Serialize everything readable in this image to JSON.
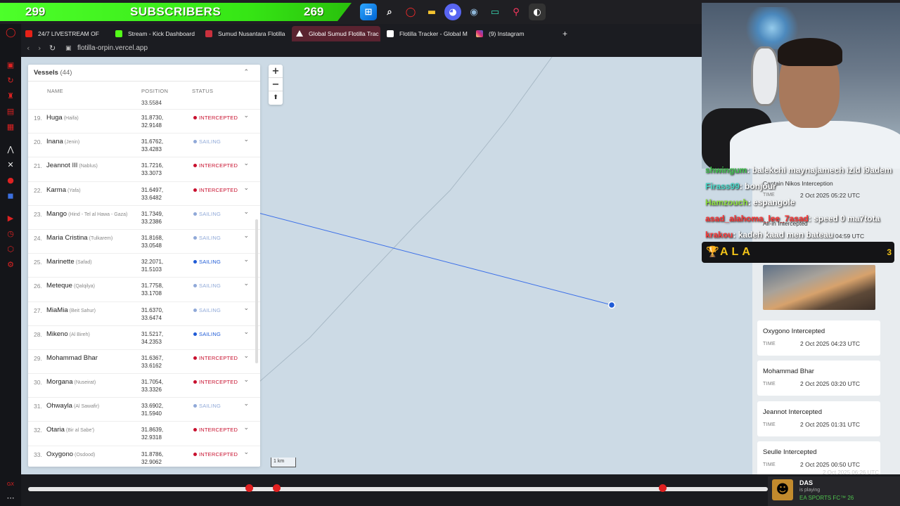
{
  "taskbar": {
    "subs_left": "299",
    "subs_label": "SUBSCRIBERS",
    "subs_right": "269",
    "icons": [
      "windows-icon",
      "search-icon",
      "opera-icon",
      "folder-icon",
      "discord-icon",
      "steam-icon",
      "app-icon",
      "location-icon",
      "game-icon"
    ]
  },
  "browser": {
    "tabs": [
      {
        "label": "24/7 LIVESTREAM OF",
        "icon_color": "#e62117"
      },
      {
        "label": "Stream - Kick Dashboard",
        "icon_color": "#53fc18"
      },
      {
        "label": "Sumud Nusantara Flotilla",
        "icon_color": "#c9303d"
      },
      {
        "label": "Global Sumud Flotilla Trac",
        "icon_color": "#ffffff"
      },
      {
        "label": "Flotilla Tracker - Global M",
        "icon_color": "#ffffff"
      },
      {
        "label": "(9) Instagram",
        "icon_color": "#d62976"
      }
    ],
    "new_tab": "+",
    "url": "flotilla-orpin.vercel.app"
  },
  "vessels": {
    "title": "Vessels",
    "count": "(44)",
    "col_name": "NAME",
    "col_position": "POSITION",
    "col_status": "STATUS",
    "partial_coord": "33.5584",
    "rows": [
      {
        "num": "19.",
        "name": "Huga",
        "city": "(Haifa)",
        "lat": "31.8730,",
        "lon": "32.9148",
        "status": "INTERCEPTED"
      },
      {
        "num": "20.",
        "name": "Inana",
        "city": "(Jenin)",
        "lat": "31.6762,",
        "lon": "33.4283",
        "status": "SAILING"
      },
      {
        "num": "21.",
        "name": "Jeannot III",
        "city": "(Nablus)",
        "lat": "31.7216,",
        "lon": "33.3073",
        "status": "INTERCEPTED"
      },
      {
        "num": "22.",
        "name": "Karma",
        "city": "(Yafa)",
        "lat": "31.6497,",
        "lon": "33.6482",
        "status": "INTERCEPTED"
      },
      {
        "num": "23.",
        "name": "Mango",
        "city": "(Hind - Tel al Hawa - Gaza)",
        "lat": "31.7349,",
        "lon": "33.2386",
        "status": "SAILING"
      },
      {
        "num": "24.",
        "name": "Maria Cristina",
        "city": "(Tulkarem)",
        "lat": "31.8168,",
        "lon": "33.0548",
        "status": "SAILING"
      },
      {
        "num": "25.",
        "name": "Marinette",
        "city": "(Safad)",
        "lat": "32.2071,",
        "lon": "31.5103",
        "status": "SAILING",
        "active": true
      },
      {
        "num": "26.",
        "name": "Meteque",
        "city": "(Qalqilya)",
        "lat": "31.7758,",
        "lon": "33.1708",
        "status": "SAILING"
      },
      {
        "num": "27.",
        "name": "MiaMia",
        "city": "(Beit Sahur)",
        "lat": "31.6370,",
        "lon": "33.6474",
        "status": "SAILING"
      },
      {
        "num": "28.",
        "name": "Mikeno",
        "city": "(Al Bireh)",
        "lat": "31.5217,",
        "lon": "34.2353",
        "status": "SAILING",
        "active": true
      },
      {
        "num": "29.",
        "name": "Mohammad Bhar",
        "city": "",
        "lat": "31.6367,",
        "lon": "33.6162",
        "status": "INTERCEPTED"
      },
      {
        "num": "30.",
        "name": "Morgana",
        "city": "(Nuseirat)",
        "lat": "31.7054,",
        "lon": "33.3326",
        "status": "INTERCEPTED"
      },
      {
        "num": "31.",
        "name": "Ohwayla",
        "city": "(Al Sawafir)",
        "lat": "33.6902,",
        "lon": "31.5940",
        "status": "SAILING"
      },
      {
        "num": "32.",
        "name": "Otaria",
        "city": "(Bir al Sabe')",
        "lat": "31.8639,",
        "lon": "32.9318",
        "status": "INTERCEPTED"
      },
      {
        "num": "33.",
        "name": "Oxygono",
        "city": "(Osdood)",
        "lat": "31.8786,",
        "lon": "32.9062",
        "status": "INTERCEPTED"
      }
    ],
    "colors": {
      "intercepted": "#c8102e",
      "sailing": "#90a9d8",
      "sailing_active": "#1f5bd6"
    }
  },
  "map": {
    "zoom_in": "+",
    "zoom_out": "−",
    "compass": "⬆",
    "scale": "1 km"
  },
  "events": {
    "time_label": "TIME",
    "partial": [
      {
        "title": "Captain Nikos Interception",
        "time": "2 Oct 2025 05:22 UTC"
      },
      {
        "title": "All-in Intercepted",
        "time": "04:59 UTC"
      }
    ],
    "cards": [
      {
        "title": "Oxygono Intercepted",
        "time": "2 Oct 2025 04:23 UTC"
      },
      {
        "title": "Mohammad Bhar",
        "time": "2 Oct 2025 03:20 UTC"
      },
      {
        "title": "Jeannot Intercepted",
        "time": "2 Oct 2025 01:31 UTC"
      },
      {
        "title": "Seulle Intercepted",
        "time": "2 Oct 2025 00:50 UTC"
      }
    ],
    "bottom_time": "2 Oct 2025 06:26 UTC"
  },
  "chat": [
    {
      "user": "shwingum",
      "color": "#3ec04a",
      "msg": ": balekchi maynajamech izid i9adem"
    },
    {
      "user": "Firass99",
      "color": "#48d8c8",
      "msg": ": bonjour"
    },
    {
      "user": "Hamzouch",
      "color": "#8fe040",
      "msg": ": espangole"
    },
    {
      "user": "asad_alahoma_lee_7asad",
      "color": "#ff3333",
      "msg": ": speed 0 ma7tota"
    },
    {
      "user": "krakou",
      "color": "#ff3a3a",
      "msg": ": kadeh kaad men bateau"
    }
  ],
  "leader": {
    "name": "ALA",
    "count": "3"
  },
  "now_playing": {
    "name": "DAS",
    "status": "is playing",
    "game": "EA SPORTS FC™ 26"
  },
  "sidebar_label": "GX"
}
